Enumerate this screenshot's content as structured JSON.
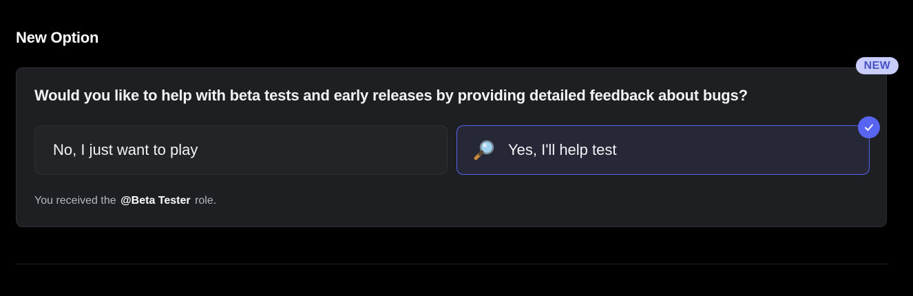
{
  "section": {
    "title": "New Option"
  },
  "badge": {
    "label": "NEW"
  },
  "question": {
    "text": "Would you like to help with beta tests and early releases by providing detailed feedback about bugs?"
  },
  "options": [
    {
      "label": "No, I just want to play",
      "selected": false
    },
    {
      "label": "Yes, I'll help test",
      "icon": "magnifying-glass-icon",
      "selected": true
    }
  ],
  "role_message": {
    "prefix": "You received the",
    "role": "@Beta Tester",
    "suffix": "role."
  },
  "colors": {
    "accent": "#5865f2",
    "badge_bg": "#c9cdfb",
    "card_bg": "#1e1f22"
  }
}
